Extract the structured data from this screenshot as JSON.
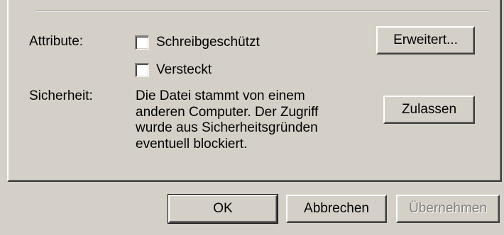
{
  "attributes": {
    "label": "Attribute:",
    "read_only_label": "Schreibgeschützt",
    "hidden_label": "Versteckt",
    "advanced_button": "Erweitert..."
  },
  "security": {
    "label": "Sicherheit:",
    "text": "Die Datei stammt von einem\nanderen Computer. Der Zugriff\nwurde aus Sicherheitsgründen\neventuell blockiert.",
    "unblock_button": "Zulassen"
  },
  "footer": {
    "ok_button": "OK",
    "cancel_button": "Abbrechen",
    "apply_button": "Übernehmen"
  }
}
